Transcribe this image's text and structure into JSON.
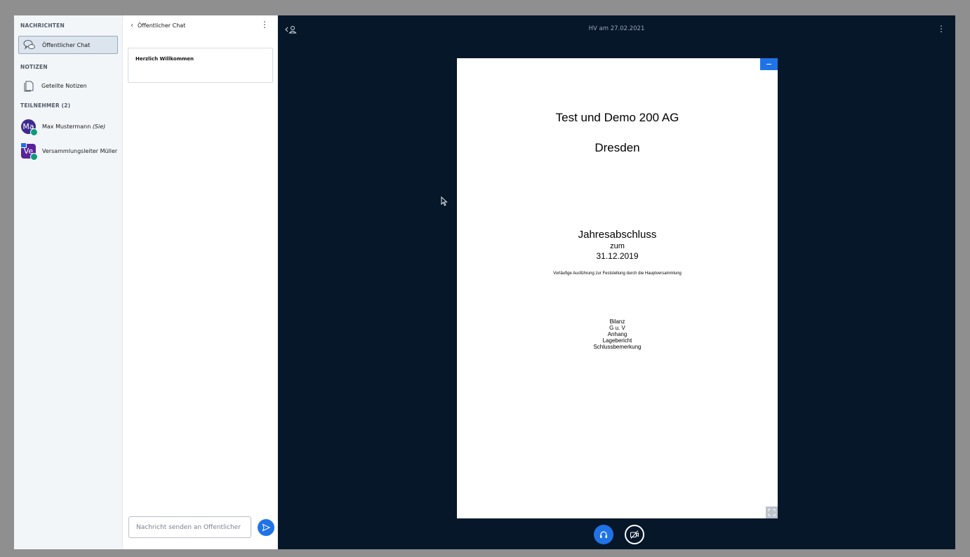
{
  "userlist": {
    "messages_title": "NACHRICHTEN",
    "public_chat_label": "Öffentlicher Chat",
    "notes_title": "NOTIZEN",
    "shared_notes_label": "Geteilte Notizen",
    "participants_title": "TEILNEHMER (2)",
    "users": [
      {
        "initials": "Ma",
        "name": "Max Mustermann",
        "suffix": "(Sie)",
        "color": "#3d2b8f"
      },
      {
        "initials": "Ve",
        "name": "Versammlungsleiter Müller",
        "suffix": "",
        "color": "#5a2399"
      }
    ]
  },
  "chat": {
    "title": "Öffentlicher Chat",
    "welcome": "Herzlich Willkommen",
    "input_placeholder": "Nachricht senden an Öffentlicher"
  },
  "stage": {
    "meeting_title": "HV am 27.02.2021",
    "slide": {
      "company": "Test und Demo 200 AG",
      "city": "Dresden",
      "heading": "Jahresabschluss",
      "zum": "zum",
      "date": "31.12.2019",
      "subtitle": "Vorläufige Ausführung zur Feststellung durch die Hauptversammlung",
      "toc": [
        "Bilanz",
        "G u. V",
        "Anhang",
        "Lagebericht",
        "Schlussbemerkung"
      ]
    }
  },
  "colors": {
    "accent": "#1f73e6",
    "stage_bg": "#06172a",
    "status_green": "#0f9a7a"
  }
}
